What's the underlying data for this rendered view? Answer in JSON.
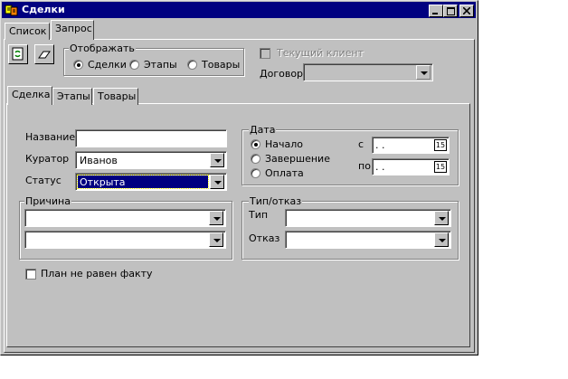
{
  "window": {
    "title": "Сделки"
  },
  "top_tabs": [
    "Список",
    "Запрос"
  ],
  "display_group": {
    "legend": "Отображать",
    "options": [
      "Сделки",
      "Этапы",
      "Товары"
    ],
    "selected": "Сделки"
  },
  "current_client": {
    "label": "Текущий клиент",
    "checked": false
  },
  "contract": {
    "label": "Договор",
    "value": ""
  },
  "inner_tabs": [
    "Сделка",
    "Этапы",
    "Товары"
  ],
  "deal": {
    "name_label": "Название",
    "name_value": "",
    "curator_label": "Куратор",
    "curator_value": "Иванов",
    "status_label": "Статус",
    "status_value": "Открыта"
  },
  "reason": {
    "legend": "Причина",
    "value1": "",
    "value2": ""
  },
  "date": {
    "legend": "Дата",
    "options": [
      "Начало",
      "Завершение",
      "Оплата"
    ],
    "selected": "Начало",
    "from_label": "с",
    "from_value": " . .",
    "to_label": "по",
    "to_value": " . .",
    "cal_icon_text": "15"
  },
  "type_refusal": {
    "legend": "Тип/отказ",
    "type_label": "Тип",
    "type_value": "",
    "refusal_label": "Отказ",
    "refusal_value": ""
  },
  "plan_fact": {
    "label": "План не равен факту",
    "checked": false
  },
  "colors": {
    "titlebar": "#000080",
    "face": "#c0c0c0",
    "selection": "#000080"
  }
}
